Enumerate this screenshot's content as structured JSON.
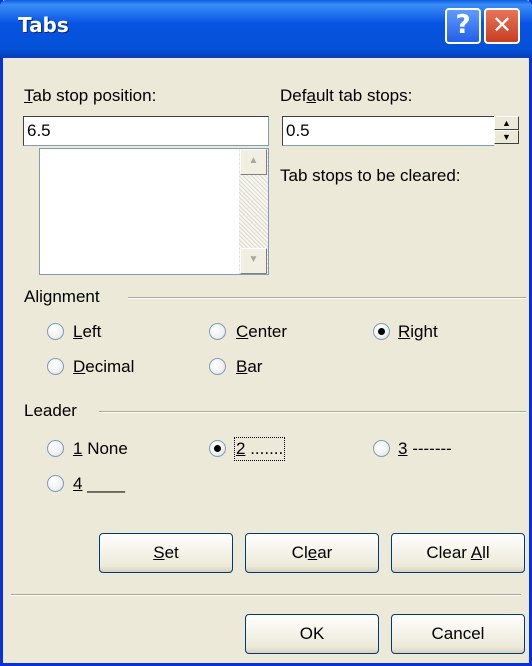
{
  "window": {
    "title": "Tabs",
    "help_label": "?",
    "close_label": "✕"
  },
  "tab_stop": {
    "label_mnemonic": "T",
    "label_rest": "ab stop position:",
    "value": "6.5",
    "list_items": []
  },
  "default_tabs": {
    "label_pre": "Def",
    "label_mnemonic": "a",
    "label_rest": "ult tab stops:",
    "value": "0.5"
  },
  "cleared_label": "Tab stops to be cleared:",
  "alignment": {
    "label": "Alignment",
    "options": [
      {
        "mn": "L",
        "rest": "eft",
        "selected": false
      },
      {
        "mn": "C",
        "rest": "enter",
        "selected": false
      },
      {
        "mn": "R",
        "rest": "ight",
        "selected": true
      },
      {
        "mn": "D",
        "rest": "ecimal",
        "selected": false
      },
      {
        "mn": "B",
        "rest": "ar",
        "selected": false
      }
    ]
  },
  "leader": {
    "label": "Leader",
    "options": [
      {
        "mn": "1",
        "rest": " None",
        "selected": false
      },
      {
        "mn": "2",
        "rest": " .......",
        "selected": true
      },
      {
        "mn": "3",
        "rest": " -------",
        "selected": false
      },
      {
        "mn": "4",
        "rest": " ____",
        "selected": false
      }
    ]
  },
  "buttons": {
    "set": {
      "mn": "S",
      "rest": "et"
    },
    "clear": {
      "pre": "Cl",
      "mn": "e",
      "rest": "ar"
    },
    "clear_all": {
      "pre": "Clear ",
      "mn": "A",
      "rest": "ll"
    },
    "ok": "OK",
    "cancel": "Cancel"
  }
}
